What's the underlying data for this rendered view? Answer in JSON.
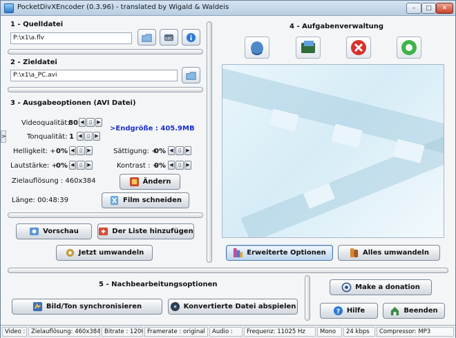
{
  "window": {
    "title": "PocketDivXEncoder (0.3.96) - translated by Wigald & Waldeis",
    "minimize": "–",
    "maximize": "□",
    "close": "✕"
  },
  "source": {
    "heading": "1 - Quelldatei",
    "path": "P:\\x1\\a.flv"
  },
  "target": {
    "heading": "2 - Zieldatei",
    "path": "P:\\x1\\a_PC.avi"
  },
  "output": {
    "heading": "3 - Ausgabeoptionen (AVI Datei)",
    "video_quality_label": "Videoqualität:",
    "video_quality_value": "80",
    "audio_quality_label": "Tonqualität:",
    "audio_quality_value": "1",
    "end_size": ">Endgröße : 405.9MB",
    "brightness_label": "Helligkeit: +",
    "brightness_value": "0%",
    "saturation_label": "Sättigung: +",
    "saturation_value": "0%",
    "volume_label": "Lautstärke: +",
    "volume_value": "0%",
    "contrast_label": "Kontrast : +",
    "contrast_value": "0%",
    "resolution_label": "Zielauflösung : 460x384",
    "length_label": "Länge: 00:48:39",
    "change_button": "Ändern",
    "cut_button": "Film schneiden"
  },
  "actions": {
    "preview": "Vorschau",
    "add_to_list": "Der Liste hinzufügen",
    "convert_now": "Jetzt umwandeln"
  },
  "tasks": {
    "heading": "4 - Aufgabenverwaltung",
    "advanced_options": "Erweiterte Optionen",
    "convert_all": "Alles umwandeln"
  },
  "post": {
    "heading": "5 - Nachbearbeitungsoptionen",
    "sync": "Bild/Ton synchronisieren",
    "play": "Konvertierte Datei abspielen"
  },
  "side_buttons": {
    "donate": "Make a donation",
    "help": "Hilfe",
    "quit": "Beenden"
  },
  "left_tab": ">",
  "status": {
    "video": "Video :",
    "resolution": "Zielauflösung: 460x384",
    "bitrate": "Bitrate : 1200",
    "framerate": "Framerate : original",
    "audio": "Audio :",
    "frequency": "Frequenz: 11025 Hz",
    "mode": "Mono",
    "kbps": "24 kbps",
    "compressor": "Compressor: MP3"
  },
  "stepper": {
    "left": "◀",
    "mid": "▯",
    "right": "▶"
  },
  "colors": {
    "accent_text": "#1a2fd0",
    "title_bar": "#c4d6ea",
    "close_red": "#c6422b"
  },
  "icons": {
    "folder": "folder-icon",
    "abc": "abc-icon",
    "info": "info-icon",
    "task_add": "mouse-add-icon",
    "task_load": "load-list-icon",
    "task_remove": "remove-icon",
    "task_start": "start-icon"
  }
}
